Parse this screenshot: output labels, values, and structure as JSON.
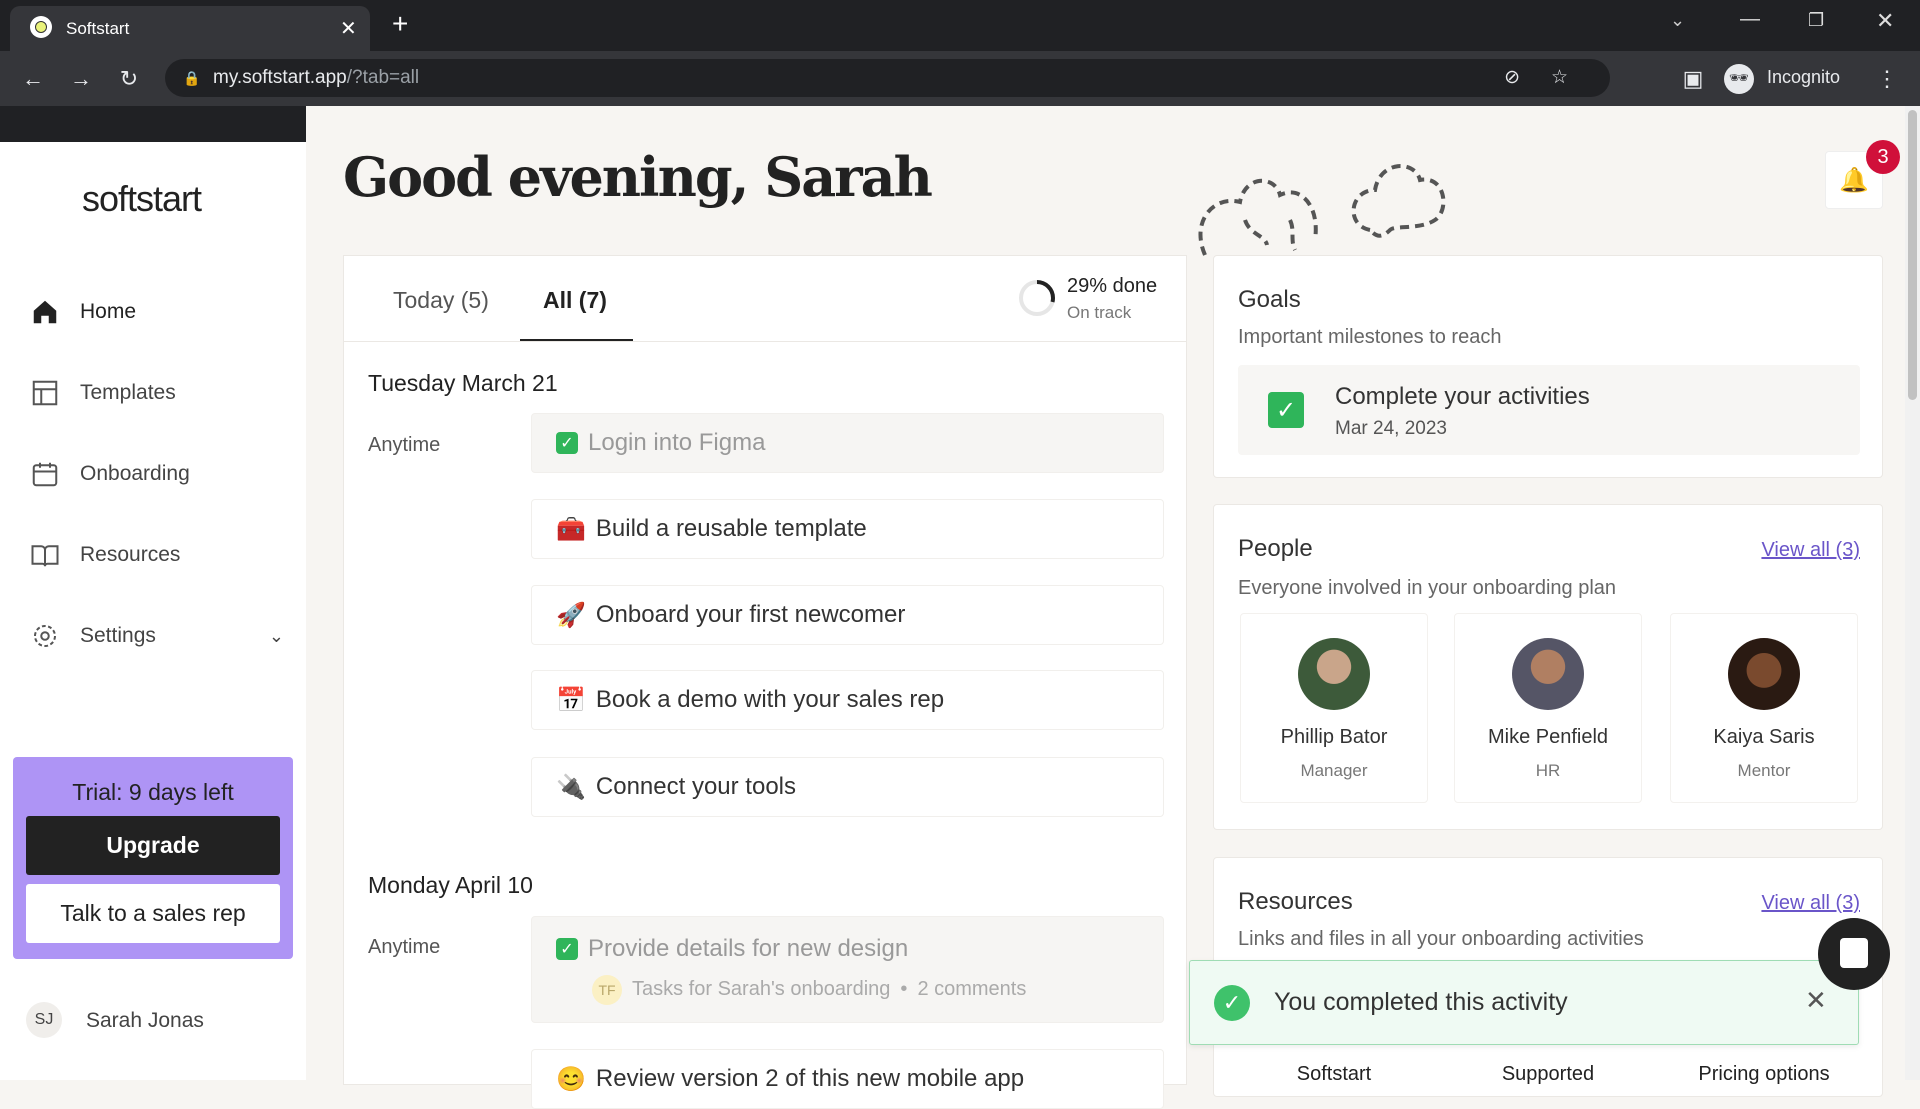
{
  "browser": {
    "tab_title": "Softstart",
    "url_main": "my.softstart.app",
    "url_rest": "/?tab=all",
    "profile": "Incognito"
  },
  "sidebar": {
    "logo": "softstart",
    "items": [
      {
        "label": "Home",
        "icon": "home-icon"
      },
      {
        "label": "Templates",
        "icon": "layout-icon"
      },
      {
        "label": "Onboarding",
        "icon": "calendar-icon"
      },
      {
        "label": "Resources",
        "icon": "book-icon"
      },
      {
        "label": "Settings",
        "icon": "gear-icon"
      }
    ],
    "trial": {
      "text": "Trial: 9 days left",
      "upgrade": "Upgrade",
      "talk": "Talk to a sales rep"
    },
    "user": {
      "initials": "SJ",
      "name": "Sarah Jonas"
    }
  },
  "greeting": "Good evening, Sarah",
  "notifications": {
    "count": "3"
  },
  "tasks": {
    "tabs": [
      {
        "label": "Today (5)"
      },
      {
        "label": "All (7)",
        "active": true
      }
    ],
    "progress": {
      "percent": 29,
      "label": "29% done",
      "status": "On track"
    },
    "groups": [
      {
        "date": "Tuesday March 21",
        "time": "Anytime",
        "items": [
          {
            "emoji": "",
            "title": "Login into Figma",
            "done": true
          },
          {
            "emoji": "🧰",
            "title": "Build a reusable template",
            "done": false
          },
          {
            "emoji": "🚀",
            "title": "Onboard your first newcomer",
            "done": false
          },
          {
            "emoji": "📅",
            "title": "Book a demo with your sales rep",
            "done": false
          },
          {
            "emoji": "🔌",
            "title": "Connect your tools",
            "done": false
          }
        ]
      },
      {
        "date": "Monday April 10",
        "time": "Anytime",
        "items": [
          {
            "title": "Provide details for new design",
            "done": true,
            "meta_initials": "TF",
            "meta_plan": "Tasks for Sarah's onboarding",
            "meta_comments": "2 comments"
          },
          {
            "emoji": "😊",
            "title": "Review version 2 of this new mobile app",
            "done": false
          }
        ]
      }
    ]
  },
  "goals": {
    "title": "Goals",
    "subtitle": "Important milestones to reach",
    "items": [
      {
        "title": "Complete your activities",
        "date": "Mar 24, 2023",
        "done": true
      }
    ]
  },
  "people": {
    "title": "People",
    "subtitle": "Everyone involved in your onboarding plan",
    "view_all": "View all (3)",
    "items": [
      {
        "name": "Phillip Bator",
        "role": "Manager"
      },
      {
        "name": "Mike Penfield",
        "role": "HR"
      },
      {
        "name": "Kaiya Saris",
        "role": "Mentor"
      }
    ]
  },
  "resources": {
    "title": "Resources",
    "subtitle": "Links and files in all your onboarding activities",
    "view_all": "View all (3)",
    "items": [
      "Softstart",
      "Supported",
      "Pricing options"
    ]
  },
  "toast": {
    "text": "You completed this activity"
  },
  "colors": {
    "accent": "#ae94f5",
    "success": "#2fb55a",
    "badge": "#d0103a",
    "link": "#6a55c9"
  }
}
